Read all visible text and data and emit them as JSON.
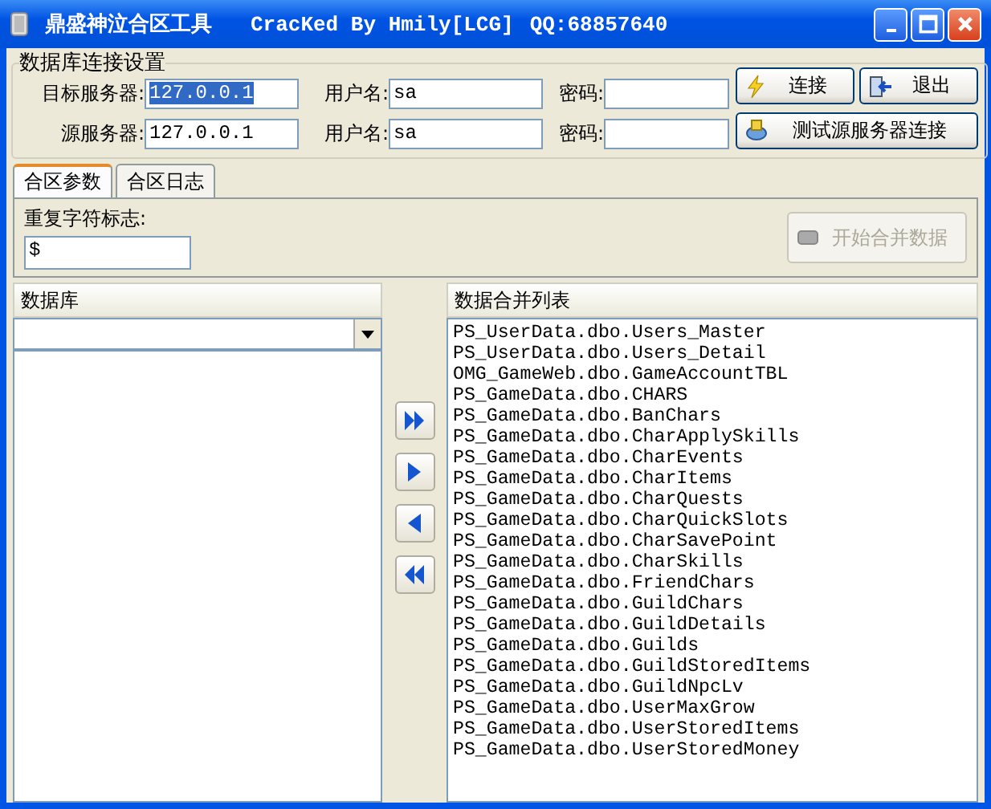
{
  "window": {
    "title": "鼎盛神泣合区工具",
    "subtitle": "CracKed By Hmily[LCG]",
    "qq": "QQ:68857640"
  },
  "connection": {
    "title": "数据库连接设置",
    "rows": [
      {
        "label": "目标服务器:",
        "server": "127.0.0.1",
        "server_highlighted": true,
        "user_label": "用户名:",
        "user": "sa",
        "password_label": "密码:"
      },
      {
        "label": "源服务器:",
        "server": "127.0.0.1",
        "server_highlighted": false,
        "user_label": "用户名:",
        "user": "sa",
        "password_label": "密码:"
      }
    ],
    "buttons": [
      {
        "kind": "connect",
        "label": "连接"
      },
      {
        "kind": "exit",
        "label": "退出"
      },
      {
        "kind": "test",
        "label": "测试源服务器连接"
      }
    ]
  },
  "tabs": [
    {
      "label": "合区参数",
      "selected": true
    },
    {
      "label": "合区日志",
      "selected": false
    }
  ],
  "params": {
    "label": "重复字符标志:",
    "value": "$",
    "merge_button": {
      "label": "开始合并数据",
      "disabled": true
    }
  },
  "database_panel": {
    "title": "数据库"
  },
  "transfer_buttons": [
    {
      "kind": "add_all"
    },
    {
      "kind": "add"
    },
    {
      "kind": "remove"
    },
    {
      "kind": "remove_all"
    }
  ],
  "merge_list": {
    "title": "数据合并列表",
    "items": [
      "PS_UserData.dbo.Users_Master",
      "PS_UserData.dbo.Users_Detail",
      "OMG_GameWeb.dbo.GameAccountTBL",
      "PS_GameData.dbo.CHARS",
      "PS_GameData.dbo.BanChars",
      "PS_GameData.dbo.CharApplySkills",
      "PS_GameData.dbo.CharEvents",
      "PS_GameData.dbo.CharItems",
      "PS_GameData.dbo.CharQuests",
      "PS_GameData.dbo.CharQuickSlots",
      "PS_GameData.dbo.CharSavePoint",
      "PS_GameData.dbo.CharSkills",
      "PS_GameData.dbo.FriendChars",
      "PS_GameData.dbo.GuildChars",
      "PS_GameData.dbo.GuildDetails",
      "PS_GameData.dbo.Guilds",
      "PS_GameData.dbo.GuildStoredItems",
      "PS_GameData.dbo.GuildNpcLv",
      "PS_GameData.dbo.UserMaxGrow",
      "PS_GameData.dbo.UserStoredItems",
      "PS_GameData.dbo.UserStoredMoney"
    ]
  }
}
